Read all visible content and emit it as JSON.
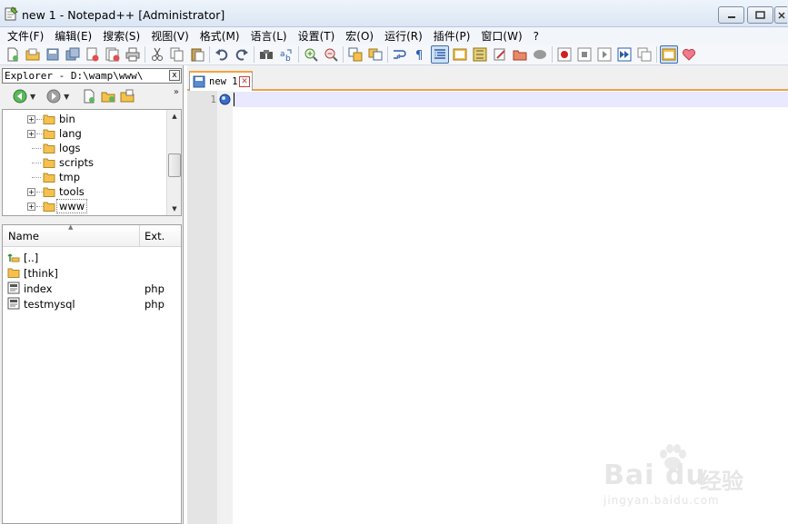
{
  "window": {
    "title": "new 1 - Notepad++ [Administrator]",
    "buttons": {
      "minimize": "─",
      "maximize": "□",
      "close": "✕"
    }
  },
  "menu": [
    "文件(F)",
    "编辑(E)",
    "搜索(S)",
    "视图(V)",
    "格式(M)",
    "语言(L)",
    "设置(T)",
    "宏(O)",
    "运行(R)",
    "插件(P)",
    "窗口(W)",
    "?"
  ],
  "toolbar": {
    "icons": [
      "new-file-icon",
      "open-file-icon",
      "save-icon",
      "save-all-icon",
      "close-icon",
      "close-all-icon",
      "print-icon",
      "cut-icon",
      "copy-icon",
      "paste-icon",
      "undo-icon",
      "redo-icon",
      "find-icon",
      "replace-icon",
      "zoom-in-icon",
      "zoom-out-icon",
      "sync-vertical-icon",
      "sync-horizontal-icon",
      "word-wrap-icon",
      "show-all-chars-icon",
      "indent-guide-icon",
      "user-language-icon",
      "function-list-icon",
      "folder-as-workspace-icon",
      "document-map-icon",
      "record-macro-icon",
      "stop-macro-icon",
      "play-macro-icon",
      "run-macro-icon",
      "save-macro-icon",
      "explorer-icon",
      "favorites-icon"
    ]
  },
  "explorer": {
    "title": "Explorer - D:\\wamp\\www\\",
    "close": "x",
    "more": "»",
    "tree": [
      {
        "label": "bin",
        "expandable": true
      },
      {
        "label": "lang",
        "expandable": true
      },
      {
        "label": "logs",
        "expandable": false
      },
      {
        "label": "scripts",
        "expandable": false
      },
      {
        "label": "tmp",
        "expandable": false
      },
      {
        "label": "tools",
        "expandable": true
      },
      {
        "label": "www",
        "expandable": true,
        "selected": true
      }
    ],
    "columns": {
      "name": "Name",
      "ext": "Ext."
    },
    "files": [
      {
        "name": "[..]",
        "ext": "",
        "icon": "parent-folder-icon"
      },
      {
        "name": "[think]",
        "ext": "",
        "icon": "folder-icon"
      },
      {
        "name": "index",
        "ext": "php",
        "icon": "php-file-icon"
      },
      {
        "name": "testmysql",
        "ext": "php",
        "icon": "php-file-icon"
      }
    ]
  },
  "editor": {
    "tab_label": "new 1",
    "line_number": "1"
  },
  "watermark": {
    "logo": "Bai du",
    "zh": "经验",
    "url": "jingyan.baidu.com"
  },
  "colors": {
    "tab_accent": "#f5a23d",
    "current_line": "#e8e8ff",
    "gutter": "#e4e4e4"
  }
}
